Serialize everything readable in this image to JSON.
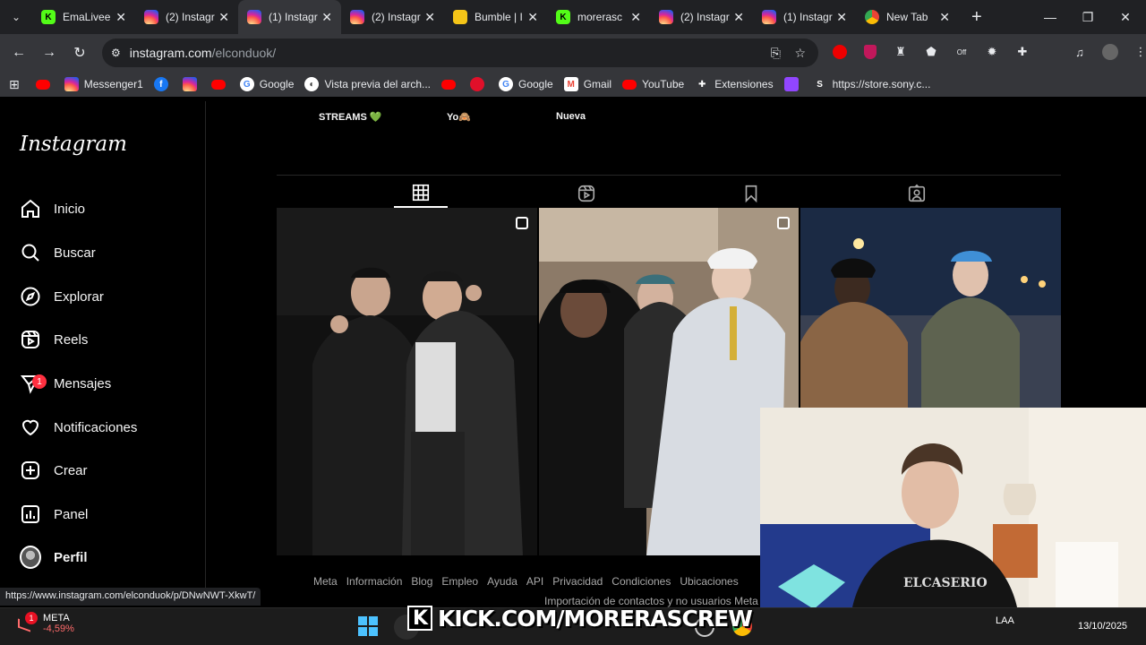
{
  "browser": {
    "tabs": [
      {
        "label": "EmaLivee",
        "favicon": "kick-icon",
        "active": false
      },
      {
        "label": "(2) Instagr",
        "favicon": "instagram-icon",
        "active": false
      },
      {
        "label": "(1) Instagr",
        "favicon": "instagram-icon",
        "active": true
      },
      {
        "label": "(2) Instagr",
        "favicon": "instagram-icon",
        "active": false
      },
      {
        "label": "Bumble | I",
        "favicon": "bumble-icon",
        "active": false
      },
      {
        "label": "morerasc",
        "favicon": "kick-icon",
        "active": false
      },
      {
        "label": "(2) Instagr",
        "favicon": "instagram-icon",
        "active": false
      },
      {
        "label": "(1) Instagr",
        "favicon": "instagram-icon",
        "active": false
      },
      {
        "label": "New Tab",
        "favicon": "chrome-icon",
        "active": false
      }
    ],
    "url_host": "instagram.com",
    "url_path": "/elconduok/",
    "bookmarks": [
      {
        "label": "",
        "icon": "youtube-icon"
      },
      {
        "label": "Messenger1",
        "icon": "instagram-icon"
      },
      {
        "label": "",
        "icon": "facebook-icon"
      },
      {
        "label": "",
        "icon": "instagram-icon"
      },
      {
        "label": "",
        "icon": "youtube-icon"
      },
      {
        "label": "Google",
        "icon": "google-icon"
      },
      {
        "label": "Vista previa del arch...",
        "icon": "globe-icon"
      },
      {
        "label": "",
        "icon": "youtube-icon"
      },
      {
        "label": "",
        "icon": "red-icon"
      },
      {
        "label": "Google",
        "icon": "google-icon"
      },
      {
        "label": "Gmail",
        "icon": "gmail-icon"
      },
      {
        "label": "YouTube",
        "icon": "youtube-icon"
      },
      {
        "label": "Extensiones",
        "icon": "puzzle-icon"
      },
      {
        "label": "",
        "icon": "twitch-icon"
      },
      {
        "label": "https://store.sony.c...",
        "icon": "sony-icon"
      }
    ],
    "status_url": "https://www.instagram.com/elconduok/p/DNwNWT-XkwT/"
  },
  "instagram": {
    "logo": "Instagram",
    "nav": [
      {
        "label": "Inicio",
        "icon": "home-icon"
      },
      {
        "label": "Buscar",
        "icon": "search-icon"
      },
      {
        "label": "Explorar",
        "icon": "compass-icon"
      },
      {
        "label": "Reels",
        "icon": "reels-icon"
      },
      {
        "label": "Mensajes",
        "icon": "messages-icon",
        "badge": "1"
      },
      {
        "label": "Notificaciones",
        "icon": "heart-icon"
      },
      {
        "label": "Crear",
        "icon": "plus-square-icon"
      },
      {
        "label": "Panel",
        "icon": "chart-icon"
      },
      {
        "label": "Perfil",
        "icon": "avatar-icon"
      }
    ],
    "highlights": [
      "STREAMS 💚",
      "Yo🙈",
      "Nueva"
    ],
    "footer_links": [
      "Meta",
      "Información",
      "Blog",
      "Empleo",
      "Ayuda",
      "API",
      "Privacidad",
      "Condiciones",
      "Ubicaciones"
    ],
    "footer_line2": "Importación de contactos y no usuarios   Meta"
  },
  "overlay": {
    "kick_text": "KICK.COM/MORERASCREW"
  },
  "taskbar": {
    "stock_name": "META",
    "stock_change": "-4,59%",
    "stock_badge": "1",
    "lang": "LAA",
    "date": "13/10/2025"
  },
  "colors": {
    "accent_notification": "#ff3040",
    "instagram_bg": "#000000",
    "chrome_toolbar": "#35363a"
  }
}
